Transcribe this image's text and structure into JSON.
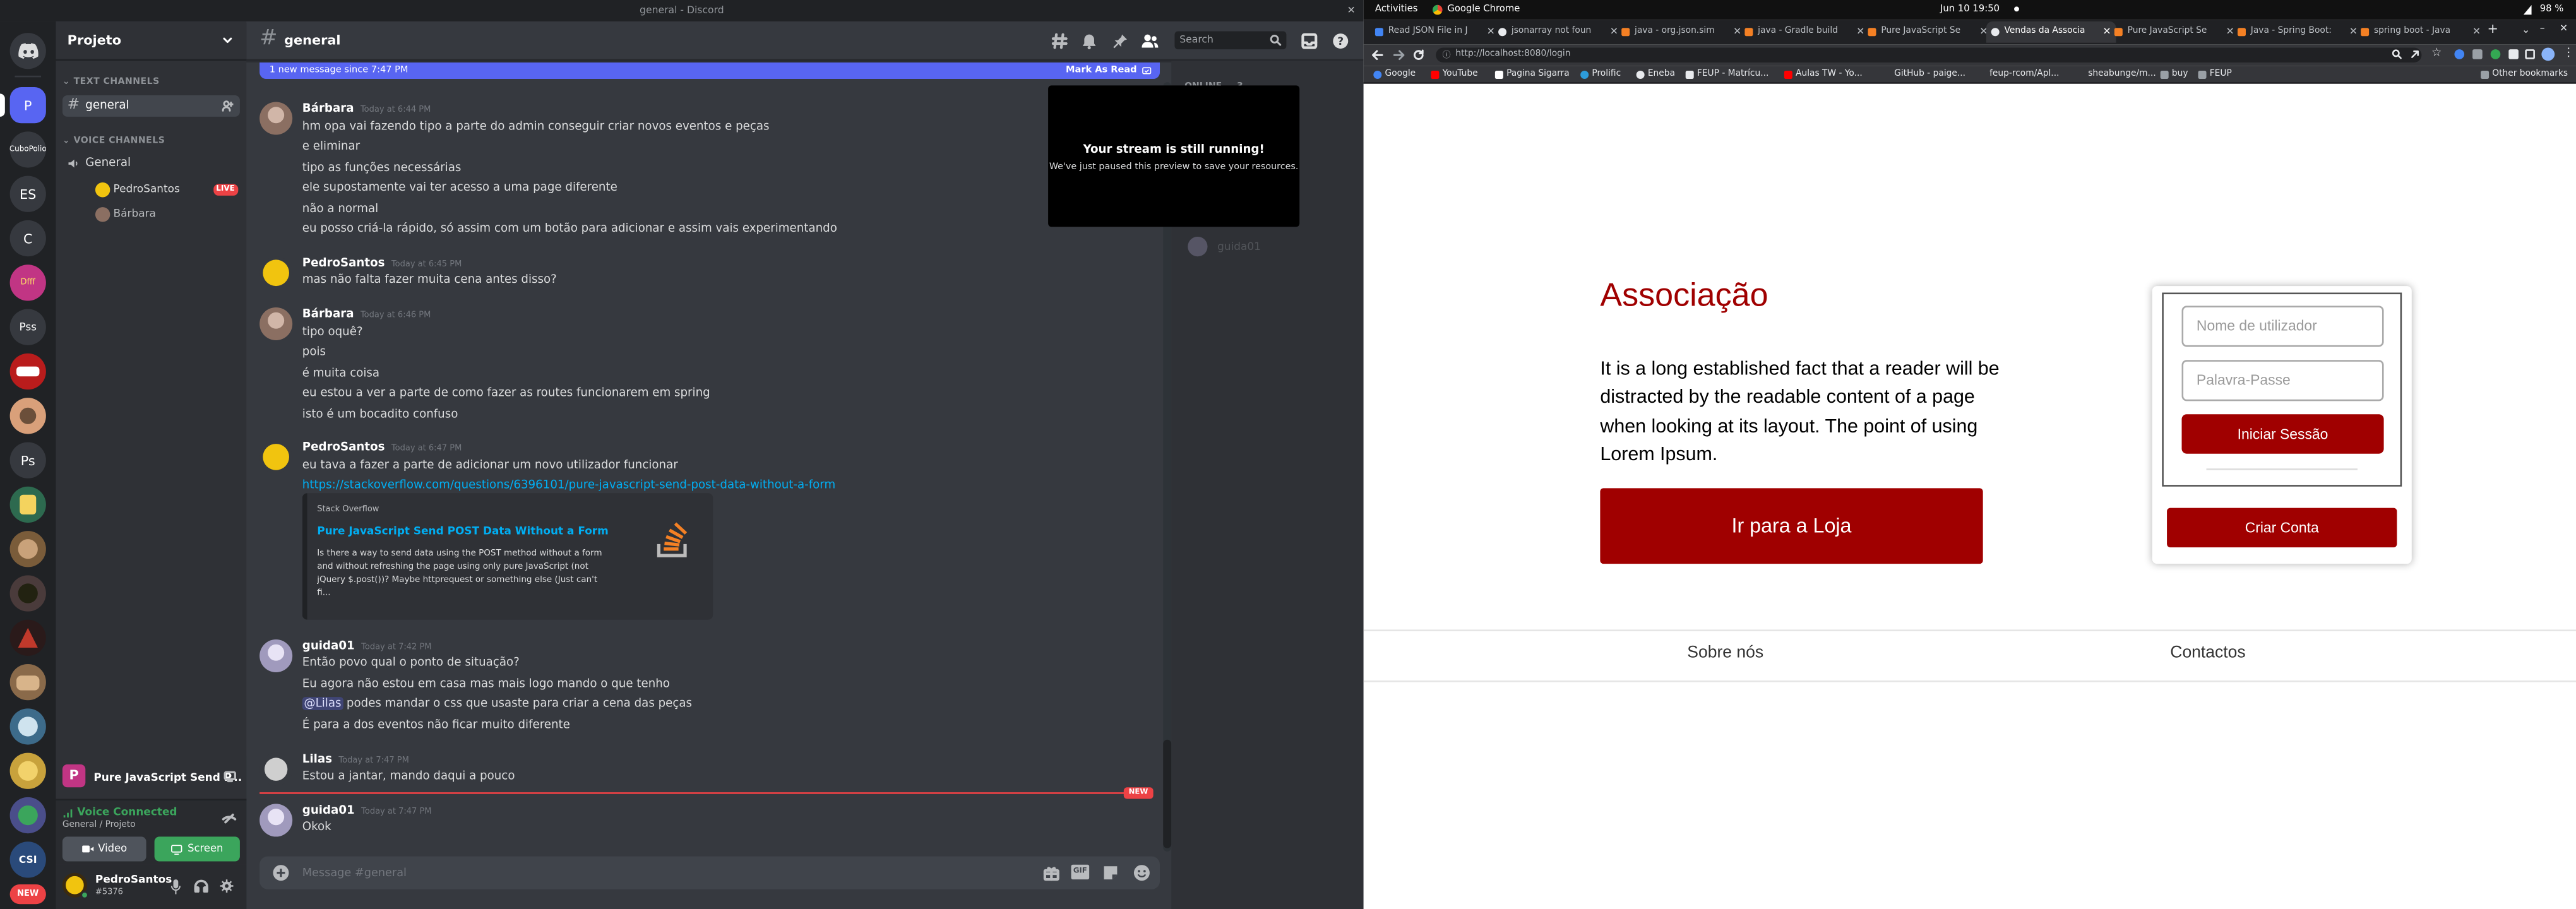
{
  "discord": {
    "window_title": "general - Discord",
    "guild": {
      "name": "Projeto"
    },
    "servers": [
      {
        "label": "P",
        "color": "#5865f2"
      },
      {
        "label": "CuboPolio",
        "color": "#36393f"
      },
      {
        "label": "ES",
        "color": "#36393f"
      },
      {
        "label": "C",
        "color": "#36393f"
      },
      {
        "label": "Dfff",
        "color": "#c13584"
      },
      {
        "label": "Pss",
        "color": "#36393f"
      },
      {
        "label": "",
        "color": "#b91c1c"
      },
      {
        "label": "",
        "color": "#6b4f3a"
      },
      {
        "label": "Ps",
        "color": "#36393f"
      },
      {
        "label": "",
        "color": "#2d6a4f"
      },
      {
        "label": "",
        "color": "#7a5c3a"
      },
      {
        "label": "",
        "color": "#4a3b3b"
      },
      {
        "label": "",
        "color": "#8b2b2b"
      },
      {
        "label": "",
        "color": "#8a6a4a"
      },
      {
        "label": "",
        "color": "#3d6b8a"
      },
      {
        "label": "",
        "color": "#c8a23c"
      },
      {
        "label": "",
        "color": "#4a4e8a"
      },
      {
        "label": "CSI",
        "color": "#2a4a7a"
      },
      {
        "label": "NEW",
        "color": "#ed4245"
      }
    ],
    "sidebar": {
      "text_category": "TEXT CHANNELS",
      "text_channels": [
        {
          "name": "general"
        }
      ],
      "voice_category": "VOICE CHANNELS",
      "voice_channels": [
        {
          "name": "General"
        }
      ],
      "voice_users": [
        {
          "name": "PedroSantos",
          "badge": "LIVE"
        },
        {
          "name": "Bárbara",
          "badge": ""
        }
      ],
      "notification": "Pure JavaScript Send P...",
      "voice_status": "Voice Connected",
      "voice_location": "General / Projeto",
      "video_label": "Video",
      "screen_label": "Screen",
      "user": {
        "name": "PedroSantos",
        "tag": "#5376"
      }
    },
    "chat": {
      "channel_name": "general",
      "search_placeholder": "Search",
      "new_messages_text": "1 new message since 7:47 PM",
      "mark_as_read": "Mark As Read",
      "composer_placeholder": "Message #general",
      "new_badge": "NEW",
      "groups": [
        {
          "author": "Bárbara",
          "time": "Today at 6:44 PM",
          "color": "#e6e6e6",
          "lines": [
            "hm opa vai fazendo tipo a parte do admin conseguir criar novos eventos e peças",
            "e eliminar",
            "tipo as funções necessárias",
            "ele supostamente vai ter acesso a uma page diferente",
            "não a normal",
            "eu posso criá-la rápido, só assim com um botão para adicionar e assim vais experimentando"
          ]
        },
        {
          "author": "PedroSantos",
          "time": "Today at 6:45 PM",
          "color": "#e6e6e6",
          "lines": [
            "mas não falta fazer muita cena antes disso?"
          ]
        },
        {
          "author": "Bárbara",
          "time": "Today at 6:46 PM",
          "color": "#e6e6e6",
          "lines": [
            "tipo oquê?",
            "pois",
            "é muita coisa",
            "eu estou a ver a parte de como fazer as routes funcionarem em spring",
            "isto é um bocadito confuso"
          ]
        },
        {
          "author": "PedroSantos",
          "time": "Today at 6:47 PM",
          "color": "#e6e6e6",
          "lines": [
            "eu tava a fazer a parte de adicionar um novo utilizador funcionar"
          ],
          "link": "https://stackoverflow.com/questions/6396101/pure-javascript-send-post-data-without-a-form"
        },
        {
          "author": "guida01",
          "time": "Today at 7:42 PM",
          "color": "#e6e6e6",
          "lines": [
            "Então povo qual o ponto de situação?",
            "Eu agora não estou em casa mas mais logo mando o que tenho"
          ],
          "mention_line": {
            "mention": "@Lilas",
            "text": " podes mandar o css que usaste para criar a cena das peças"
          },
          "last_line": "É para a dos eventos não ficar muito diferente"
        },
        {
          "author": "Lilas",
          "time": "Today at 7:47 PM",
          "color": "#e6e6e6",
          "lines": [
            "Estou a jantar, mando daqui a pouco"
          ]
        },
        {
          "author": "guida01",
          "time": "Today at 7:47 PM",
          "color": "#e6e6e6",
          "lines": [
            "Okok"
          ]
        }
      ],
      "embed": {
        "provider": "Stack Overflow",
        "title": "Pure JavaScript Send POST Data Without a Form",
        "desc1": "Is there a way to send data using the POST method without a form",
        "desc2": "and without refreshing the page using only pure JavaScript (not",
        "desc3": "jQuery $.post())? Maybe httprequest or something else (Just can't",
        "desc4": "fi..."
      }
    },
    "members": {
      "header": "ONLINE — 3",
      "users": [
        "guida01"
      ]
    },
    "stream_overlay": {
      "title": "Your stream is still running!",
      "subtitle": "We've just paused this preview to save your resources."
    }
  },
  "system": {
    "activities": "Activities",
    "app_name": "Google Chrome",
    "clock": "Jun 10  19:50",
    "battery": "98 %"
  },
  "chrome": {
    "tabs": [
      {
        "title": "Read JSON File in J",
        "favicon_color": "#4285f4"
      },
      {
        "title": "jsonarray not foun",
        "favicon_color": "#e8eaed"
      },
      {
        "title": "java - org.json.sim",
        "favicon_color": "#f48024"
      },
      {
        "title": "java - Gradle build",
        "favicon_color": "#f48024"
      },
      {
        "title": "Pure JavaScript Se",
        "favicon_color": "#f48024"
      },
      {
        "title": "Vendas da Associa",
        "favicon_color": "#e8eaed"
      },
      {
        "title": "Pure JavaScript Se",
        "favicon_color": "#f48024"
      },
      {
        "title": "Java - Spring Boot:",
        "favicon_color": "#f48024"
      },
      {
        "title": "spring boot - Java",
        "favicon_color": "#f48024"
      }
    ],
    "active_tab": 5,
    "url": "http://localhost:8080/login",
    "bookmarks": [
      {
        "label": "Google",
        "color": "#4285f4"
      },
      {
        "label": "YouTube",
        "color": "#ff0000"
      },
      {
        "label": "Pagina Sigarra",
        "color": "#ffffff"
      },
      {
        "label": "Prolific",
        "color": "#2d9cdb"
      },
      {
        "label": "Eneba",
        "color": "#e8eaed"
      },
      {
        "label": "FEUP - Matrícu...",
        "color": "#e8eaed"
      },
      {
        "label": "Aulas TW - Yo...",
        "color": "#ff0000"
      },
      {
        "label": "GitHub - paige...",
        "color": "#e8eaed"
      },
      {
        "label": "feup-rcom/Apl...",
        "color": "#e8eaed"
      },
      {
        "label": "sheabunge/m...",
        "color": "#e8eaed"
      },
      {
        "label": "buy",
        "color": "#9aa0a6"
      },
      {
        "label": "FEUP",
        "color": "#9aa0a6"
      }
    ],
    "other_bookmarks": "Other bookmarks"
  },
  "webpage": {
    "title": "Associação",
    "paragraph": "It is a long established fact that a reader will be distracted by the readable content of a page when looking at its layout. The point of using Lorem Ipsum.",
    "store_button": "Ir para a Loja",
    "username_placeholder": "Nome de utilizador",
    "password_placeholder": "Palavra-Passe",
    "login_button": "Iniciar Sessão",
    "register_button": "Criar Conta",
    "nav": {
      "about": "Sobre nós",
      "contacts": "Contactos"
    },
    "accent_color": "#a00000"
  }
}
